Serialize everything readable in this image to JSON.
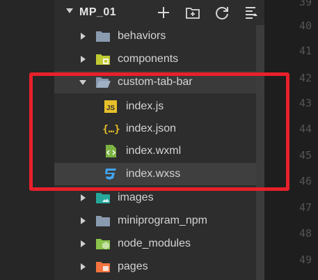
{
  "explorer": {
    "project_title": "MP_01",
    "toolbar": {
      "new_file_icon": "plus-icon",
      "new_folder_icon": "new-folder-icon",
      "refresh_icon": "refresh-icon",
      "collapse_icon": "collapse-icon"
    },
    "items": [
      {
        "label": "behaviors",
        "icon": "folder-icon",
        "expanded": false
      },
      {
        "label": "components",
        "icon": "components-folder-icon",
        "expanded": false
      },
      {
        "label": "custom-tab-bar",
        "icon": "folder-open-icon",
        "expanded": true
      },
      {
        "label": "index.js",
        "icon": "js-file-icon"
      },
      {
        "label": "index.json",
        "icon": "json-file-icon"
      },
      {
        "label": "index.wxml",
        "icon": "wxml-file-icon"
      },
      {
        "label": "index.wxss",
        "icon": "wxss-file-icon"
      },
      {
        "label": "images",
        "icon": "images-folder-icon",
        "expanded": false
      },
      {
        "label": "miniprogram_npm",
        "icon": "folder-icon",
        "expanded": false
      },
      {
        "label": "node_modules",
        "icon": "node-folder-icon",
        "expanded": false
      },
      {
        "label": "pages",
        "icon": "pages-folder-icon",
        "expanded": false
      }
    ]
  },
  "editor": {
    "line_numbers": [
      "39",
      "40",
      "41",
      "42",
      "43",
      "44",
      "45",
      "46",
      "47",
      "48",
      "49"
    ]
  },
  "colors": {
    "highlight": "#e8202a",
    "folder": "#8a9bb0",
    "js": "#e8c02a",
    "json": "#e8c02a",
    "wxml": "#7cb342",
    "wxss": "#42a5f5"
  }
}
